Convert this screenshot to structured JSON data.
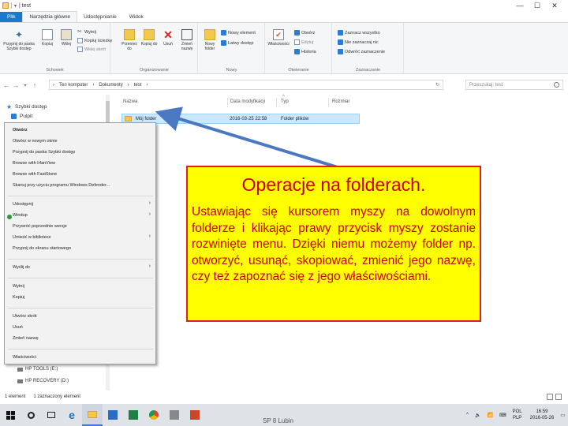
{
  "window": {
    "title": "| test",
    "controls": {
      "minimize": "—",
      "maximize": "☐",
      "close": "✕"
    }
  },
  "ribbon_tabs": [
    "Plik",
    "Narzędzia główne",
    "Udostępnianie",
    "Widok"
  ],
  "ribbon": {
    "clipboard": {
      "label": "Schowek",
      "pin": "Przypnij do paska Szybki dostęp",
      "copy": "Kopiuj",
      "paste": "Wklej",
      "cut": "Wytnij",
      "copy_path": "Kopiuj ścieżkę",
      "paste_shortcut": "Wklej skrót"
    },
    "organize": {
      "label": "Organizowanie",
      "move_to": "Przenieś do",
      "copy_to": "Kopiuj do",
      "delete": "Usuń",
      "rename": "Zmień nazwę"
    },
    "new": {
      "label": "Nowy",
      "new_folder": "Nowy folder",
      "new_item": "Nowy element",
      "easy_access": "Łatwy dostęp"
    },
    "open": {
      "label": "Otwieranie",
      "properties": "Właściwości",
      "open": "Otwórz",
      "edit": "Edytuj",
      "history": "Historia"
    },
    "select": {
      "label": "Zaznaczanie",
      "select_all": "Zaznacz wszystko",
      "select_none": "Nie zaznaczaj nic",
      "invert": "Odwróć zaznaczenie"
    }
  },
  "address": {
    "crumbs": [
      "Ten komputer",
      "Dokumenty",
      "test"
    ],
    "search_placeholder": "Przeszukaj: test"
  },
  "nav_pane": {
    "items": [
      "Szybki dostęp",
      "Pulpit"
    ]
  },
  "file_list": {
    "columns": [
      "Nazwa",
      "Data modyfikacji",
      "Typ",
      "Rozmiar"
    ],
    "rows": [
      {
        "name": "Mój folder",
        "date": "2016-03-25 22:58",
        "type": "Folder plików",
        "size": ""
      }
    ]
  },
  "context_menu": {
    "group1": [
      "Otwórz",
      "Otwórz w nowym oknie",
      "Przypnij do paska Szybki dostęp",
      "Browse with IrfanView",
      "Browse with FastStone",
      "Skanuj przy użyciu programu Windows Defender..."
    ],
    "group2": [
      "Udostępnij",
      "Windup",
      "Przywróć poprzednie wersje",
      "Umieść w bibliotece",
      "Przypnij do ekranu startowego"
    ],
    "group3": [
      "Wyślij do"
    ],
    "group4": [
      "Wytnij",
      "Kopiuj"
    ],
    "group5": [
      "Utwórz skrót",
      "Usuń",
      "Zmień nazwę"
    ],
    "group6": [
      "Właściwości"
    ]
  },
  "tree_below": [
    "HP TOOLS (E:)",
    "HP RECOVERY (D:)"
  ],
  "status_bar": {
    "count": "1 element",
    "selected": "1 zaznaczony element"
  },
  "taskbar": {
    "label": "SP 8 Lubin",
    "lang_top": "POL",
    "lang_bottom": "PLP",
    "time": "16:59",
    "date": "2016-05-26"
  },
  "callout": {
    "title": "Operacje na folderach.",
    "body": "Ustawiając się kursorem myszy na dowolnym folderze i klikając prawy przycisk myszy zostanie rozwinięte menu. Dzięki niemu możemy folder np. otworzyć, usunąć, skopiować, zmienić jego nazwę, czy też zapoznać się z jego właściwościami."
  },
  "colors": {
    "callout_bg": "#ffff00",
    "callout_border": "#e02020",
    "callout_text": "#cc0000",
    "arrow": "#4a78c2",
    "selection": "#cce8ff",
    "file_tab": "#1979ca"
  }
}
